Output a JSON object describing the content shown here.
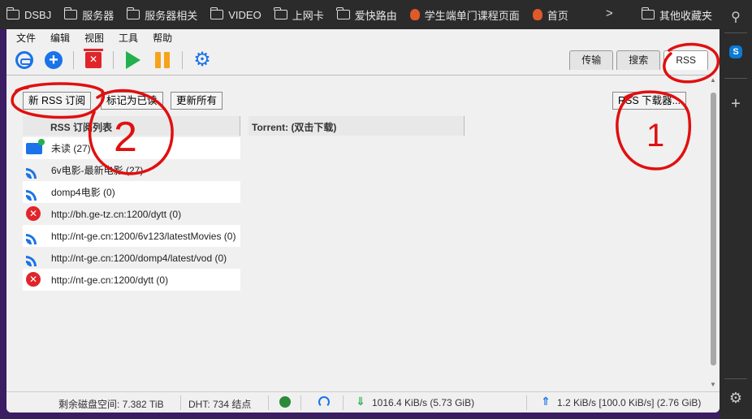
{
  "bookmarks": [
    "DSBJ",
    "服务器",
    "服务器相关",
    "VIDEO",
    "上网卡",
    "爱快路由",
    "学生端单门课程页面",
    "首页"
  ],
  "bookmarks_more": ">",
  "bookmarks_other": "其他收藏夹",
  "menu": [
    "文件",
    "编辑",
    "视图",
    "工具",
    "帮助"
  ],
  "tabs": [
    "传输",
    "搜索",
    "RSS"
  ],
  "rss": {
    "new_button": "新 RSS 订阅",
    "mark_read_button": "标记为已读",
    "update_all_button": "更新所有",
    "downloader_button": "RSS 下载器...",
    "feeds_header": "RSS 订阅列表",
    "torrent_header": "Torrent:   (双击下载)",
    "feeds": [
      {
        "label": "未读 (27)",
        "icon": "mail-icon"
      },
      {
        "label": "6v电影-最新电影 (27)",
        "icon": "rss-icon"
      },
      {
        "label": "domp4电影 (0)",
        "icon": "rss-icon"
      },
      {
        "label": "http://bh.ge-tz.cn:1200/dytt (0)",
        "icon": "error-icon"
      },
      {
        "label": "http://nt-ge.cn:1200/6v123/latestMovies (0)",
        "icon": "rss-icon"
      },
      {
        "label": "http://nt-ge.cn:1200/domp4/latest/vod (0)",
        "icon": "rss-icon"
      },
      {
        "label": "http://nt-ge.cn:1200/dytt (0)",
        "icon": "error-icon"
      }
    ]
  },
  "status": {
    "free_space": "剩余磁盘空间: 7.382 TiB",
    "dht": "DHT: 734 结点",
    "download": "1016.4 KiB/s (5.73 GiB)",
    "upload": "1.2 KiB/s [100.0 KiB/s] (2.76 GiB)"
  },
  "annotations": [
    "1",
    "2"
  ],
  "colors": {
    "accent": "#1a73e8",
    "error": "#e0252a",
    "play": "#22b14c",
    "pause": "#f7a21b",
    "annotation": "#e01010"
  }
}
